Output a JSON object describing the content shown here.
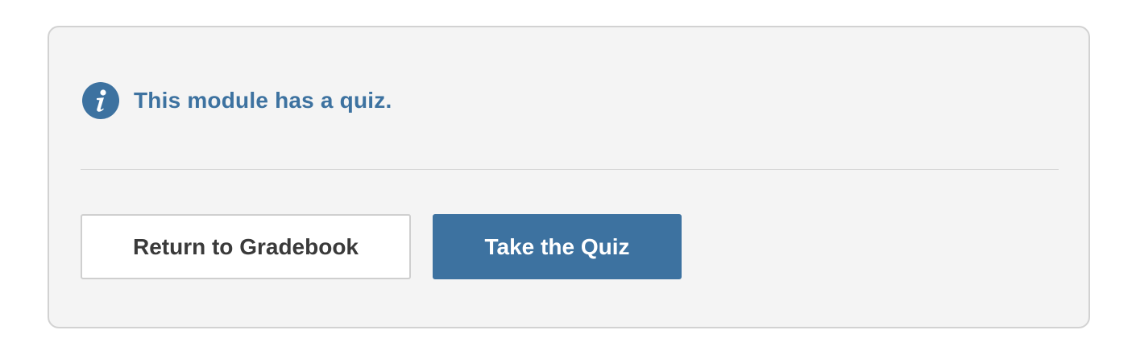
{
  "colors": {
    "accent": "#3d72a0",
    "panel_background": "#f4f4f4",
    "panel_border": "#d2d2d2"
  },
  "notice": {
    "icon": "info-icon",
    "text": "This module has a quiz."
  },
  "actions": {
    "return_label": "Return to Gradebook",
    "quiz_label": "Take the Quiz"
  }
}
